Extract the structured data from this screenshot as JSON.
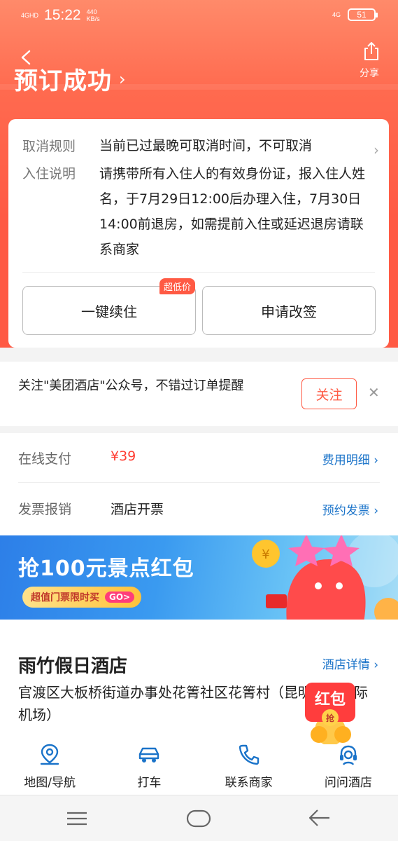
{
  "status_bar": {
    "network": "4GHD",
    "time": "15:22",
    "speed_value": "440",
    "speed_unit": "KB/s",
    "network_right": "4G",
    "battery": "51"
  },
  "header": {
    "title": "预订成功",
    "share_label": "分享"
  },
  "card": {
    "cancel_label": "取消规则",
    "cancel_text": "当前已过最晚可取消时间，不可取消",
    "checkin_label": "入住说明",
    "checkin_text": "请携带所有入住人的有效身份证，报入住人姓名，于7月29日12:00后办理入住，7月30日14:00前退房，如需提前入住或延迟退房请联系商家",
    "extend_button": "一键续住",
    "extend_badge": "超低价",
    "change_button": "申请改签"
  },
  "follow": {
    "text": "关注\"美团酒店\"公众号，不错过订单提醒",
    "button": "关注"
  },
  "payment": {
    "online_label": "在线支付",
    "online_value": "¥39",
    "online_link": "费用明细",
    "invoice_label": "发票报销",
    "invoice_value": "酒店开票",
    "invoice_link": "预约发票"
  },
  "banner": {
    "title": "抢100元景点红包",
    "subtitle": "超值门票限时买",
    "go": "GO>"
  },
  "hotel": {
    "name": "雨竹假日酒店",
    "details_link": "酒店详情",
    "address": "官渡区大板桥街道办事处花箐社区花箐村（昆明长水国际机场）",
    "redpack_title": "红包",
    "redpack_sub": "抢"
  },
  "actions": [
    {
      "label": "地图/导航",
      "icon": "map-pin-icon"
    },
    {
      "label": "打车",
      "icon": "car-icon"
    },
    {
      "label": "联系商家",
      "icon": "phone-icon"
    },
    {
      "label": "问问酒店",
      "icon": "headset-icon"
    }
  ],
  "colors": {
    "accent": "#ff5a44",
    "link": "#1a73c9",
    "price": "#ff3b30"
  }
}
